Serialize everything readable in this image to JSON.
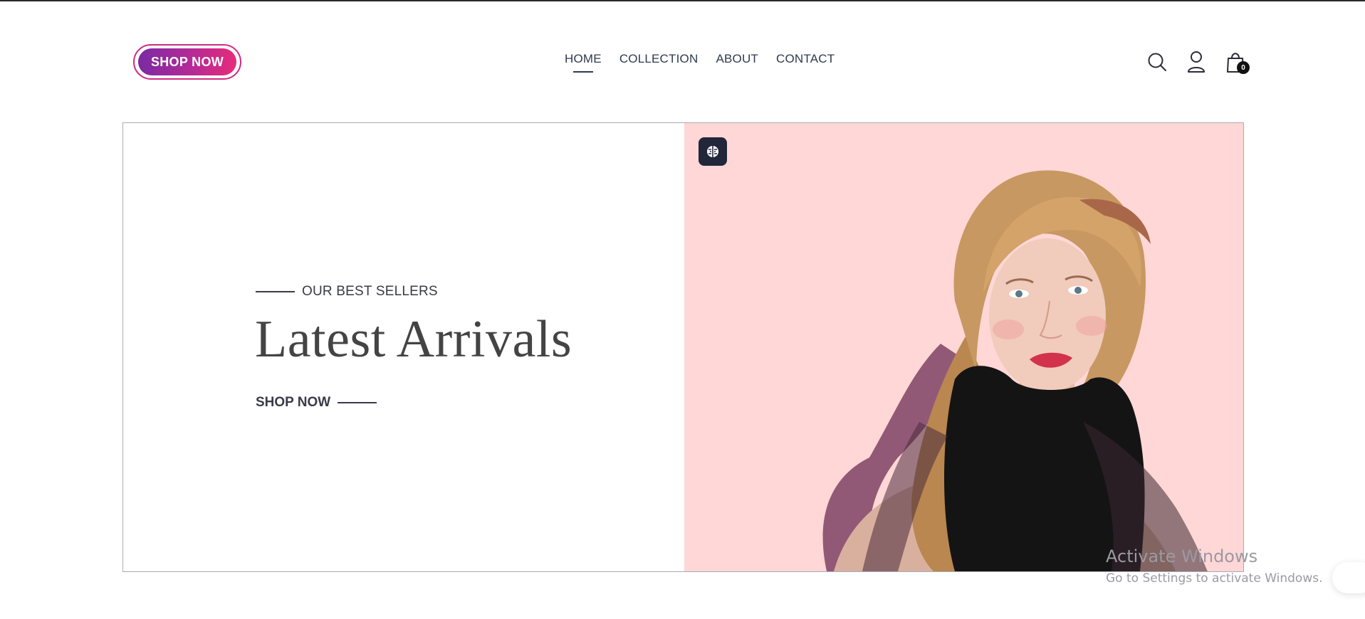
{
  "header": {
    "logo_button": "SHOP NOW",
    "nav": [
      {
        "label": "HOME",
        "active": true
      },
      {
        "label": "COLLECTION",
        "active": false
      },
      {
        "label": "ABOUT",
        "active": false
      },
      {
        "label": "CONTACT",
        "active": false
      }
    ],
    "icons": [
      "search-icon",
      "user-icon",
      "shopping-bag-icon"
    ],
    "cart_count": "0"
  },
  "hero": {
    "kicker": "OUR BEST SELLERS",
    "title": "Latest Arrivals",
    "cta": "SHOP NOW",
    "image_background": "#fed7d6",
    "badge_icon": "brain-icon"
  },
  "overlay": {
    "activation_title": "Activate Windows",
    "activation_sub": "Go to Settings to activate Windows."
  },
  "colors": {
    "brand_gradient_start": "#7b2aa3",
    "brand_gradient_end": "#e72b7a",
    "text_primary": "#2e3a4e",
    "hero_title": "#444444"
  }
}
